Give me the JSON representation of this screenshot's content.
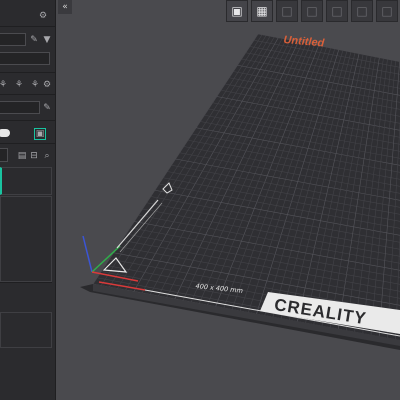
{
  "app": {
    "collapse_glyph": "«"
  },
  "toolbar": {
    "items": [
      {
        "name": "view-3d-cube-icon",
        "glyph": "▣",
        "state": "active"
      },
      {
        "name": "grid-layout-icon",
        "glyph": "▦",
        "state": "active"
      },
      {
        "name": "tool-3-icon",
        "glyph": "□",
        "state": "dim"
      },
      {
        "name": "tool-4-icon",
        "glyph": "□",
        "state": "dim"
      },
      {
        "name": "tool-5-icon",
        "glyph": "□",
        "state": "dim"
      },
      {
        "name": "tool-6-icon",
        "glyph": "□",
        "state": "dim"
      },
      {
        "name": "tool-7-icon",
        "glyph": "□",
        "state": "dim"
      }
    ]
  },
  "sidebar": {
    "settings_glyph": "⚙",
    "edit_glyph": "✎",
    "wifi_glyph": "▼",
    "save_glyph": "▤",
    "minus_glyph": "⊟",
    "search_glyph": "⌕"
  },
  "viewport": {
    "project_name": "Untitled",
    "bed_size": "400 x 400 mm",
    "brand": "CREALITY"
  },
  "colors": {
    "bg": "#4a4a4e",
    "panel": "#2b2b2e",
    "bed": "#2f2f33",
    "grid": "#4a4a50",
    "accent_teal": "#19c3a0",
    "project_name": "#d9603a"
  }
}
